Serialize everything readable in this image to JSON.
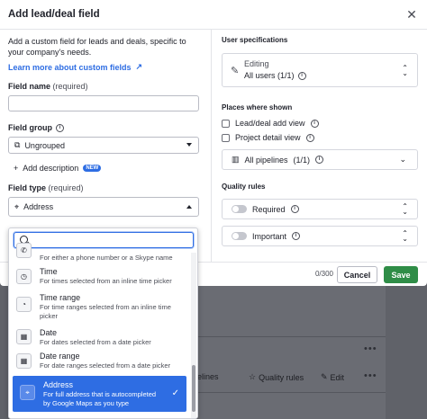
{
  "modal": {
    "title": "Add lead/deal field",
    "intro": "Add a custom field for leads and deals, specific to your company's needs.",
    "learn_more": "Learn more about custom fields",
    "field_name_label": "Field name",
    "field_name_req": "(required)",
    "field_name_value": "",
    "field_group_label": "Field group",
    "field_group_value": "Ungrouped",
    "add_description": "Add description",
    "new_badge": "NEW",
    "field_type_label": "Field type",
    "field_type_req": "(required)",
    "field_type_value": "Address"
  },
  "right": {
    "user_spec_title": "User specifications",
    "editing_label": "Editing",
    "editing_value": "All users (1/1)",
    "places_title": "Places where shown",
    "places": [
      "Lead/deal add view",
      "Project detail view"
    ],
    "pipelines_value": "All pipelines",
    "pipelines_count": "(1/1)",
    "quality_title": "Quality rules",
    "quality": [
      "Required",
      "Important"
    ]
  },
  "footer": {
    "counter": "0/300",
    "cancel": "Cancel",
    "save": "Save"
  },
  "dropdown": {
    "search_placeholder": "",
    "items": [
      {
        "title": "",
        "desc": "For either a phone number or a Skype name",
        "icon": "phone-icon"
      },
      {
        "title": "Time",
        "desc": "For times selected from an inline time picker",
        "icon": "clock-icon"
      },
      {
        "title": "Time range",
        "desc": "For time ranges selected from an inline time picker",
        "icon": "time-range-icon"
      },
      {
        "title": "Date",
        "desc": "For dates selected from a date picker",
        "icon": "calendar-icon"
      },
      {
        "title": "Date range",
        "desc": "For date ranges selected from a date picker",
        "icon": "calendar-range-icon"
      },
      {
        "title": "Address",
        "desc": "For full address that is autocompleted by Google Maps as you type",
        "icon": "map-pin-icon",
        "selected": true
      }
    ]
  },
  "background": {
    "pipelines": "pelines",
    "quality_rules": "Quality rules",
    "edit": "Edit"
  }
}
